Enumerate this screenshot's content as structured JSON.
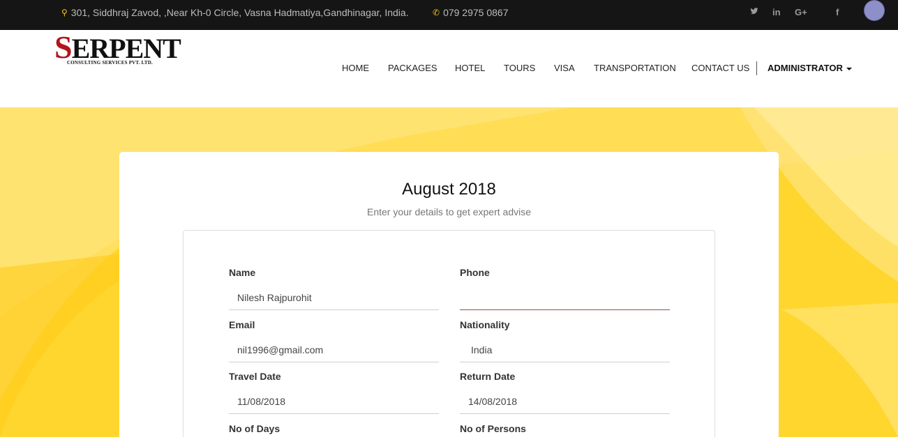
{
  "topbar": {
    "address": "301, Siddhraj Zavod, ,Near Kh-0 Circle, Vasna Hadmatiya,Gandhinagar, India.",
    "phone": "079 2975 0867",
    "social": [
      {
        "name": "twitter-icon",
        "glyph": "𝕥"
      },
      {
        "name": "linkedin-icon",
        "glyph": "in"
      },
      {
        "name": "google-plus-icon",
        "glyph": "G+"
      },
      {
        "name": "facebook-icon",
        "glyph": "f"
      }
    ]
  },
  "logo": {
    "first_letter": "S",
    "rest": "ERPENT",
    "tagline": "CONSULTING SERVICES PVT. LTD."
  },
  "nav": {
    "home": "HOME",
    "packages": "PACKAGES",
    "hotel": "HOTEL",
    "tours": "TOURS",
    "visa": "VISA",
    "transportation": "TRANSPORTATION",
    "contact": "CONTACT US",
    "admin": "ADMINISTRATOR"
  },
  "card": {
    "title": "August 2018",
    "subtitle": "Enter your details to get expert advise"
  },
  "form": {
    "name": {
      "label": "Name",
      "value": "Nilesh Rajpurohit"
    },
    "phone": {
      "label": "Phone",
      "value": ""
    },
    "email": {
      "label": "Email",
      "value": "nil1996@gmail.com"
    },
    "nationality": {
      "label": "Nationality",
      "value": "India"
    },
    "travel_date": {
      "label": "Travel Date",
      "value": "11/08/2018"
    },
    "return_date": {
      "label": "Return Date",
      "value": "14/08/2018"
    },
    "days": {
      "label": "No of Days"
    },
    "persons": {
      "label": "No of Persons"
    }
  },
  "colors": {
    "topbar": "#151515",
    "accent_yellow": "#ffd62e",
    "logo_red": "#b3141c",
    "error_underline": "#a94442"
  }
}
